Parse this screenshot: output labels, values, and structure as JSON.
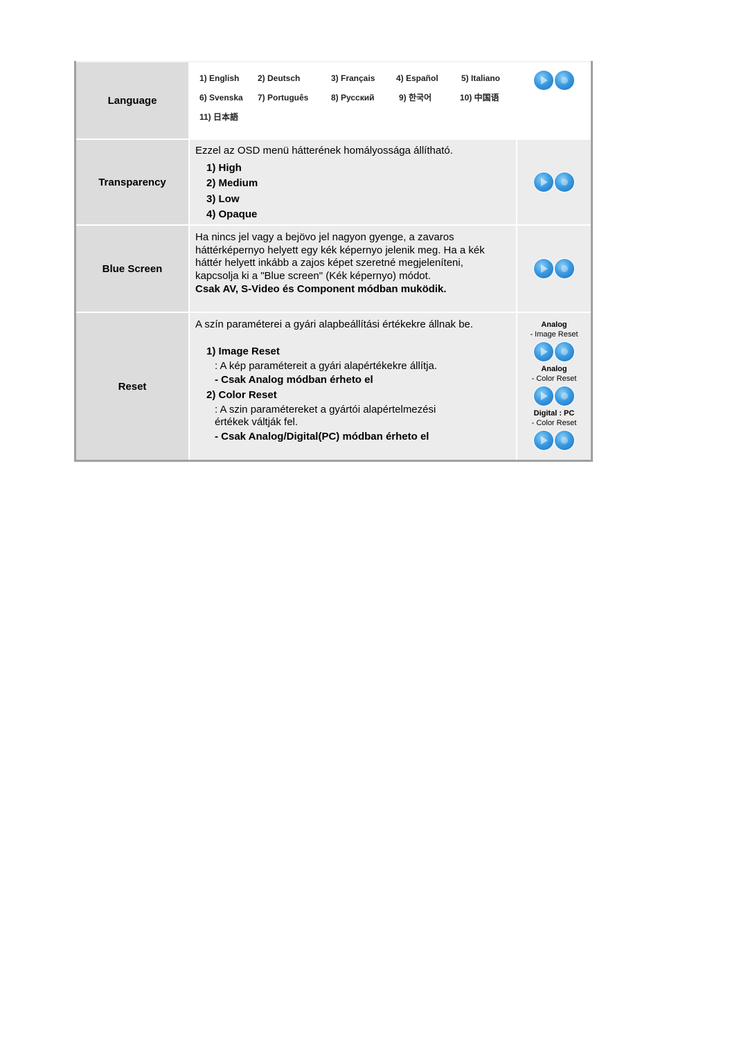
{
  "rows": [
    {
      "label": "Language",
      "languages": [
        [
          "1) English",
          "2) Deutsch",
          "3) Français",
          "4) Español",
          "5) Italiano"
        ],
        [
          "6) Svenska",
          "7) Português",
          "8) Pусский",
          "9) 한국어",
          "10) 中国语"
        ],
        [
          "11) 日本語"
        ]
      ],
      "icons": [
        "play-button-icon",
        "enter-button-icon"
      ]
    },
    {
      "label": "Transparency",
      "description": "Ezzel az OSD menü hátterének homályossága állítható.",
      "options": [
        "1) High",
        "2) Medium",
        "3) Low",
        "4) Opaque"
      ],
      "icons": [
        "play-button-icon",
        "enter-button-icon"
      ]
    },
    {
      "label": "Blue Screen",
      "description": "Ha nincs jel vagy a bejövo jel nagyon gyenge, a zavaros háttérképernyo helyett egy kék képernyo jelenik meg. Ha a kék háttér helyett inkább a zajos képet szeretné megjeleníteni, kapcsolja ki a \"Blue screen\" (Kék képernyo) módot.",
      "note": "Csak AV, S-Video és Component módban muködik.",
      "icons": [
        "play-button-icon",
        "enter-button-icon"
      ]
    },
    {
      "label": "Reset",
      "description": "A szín paraméterei a gyári alapbeállítási értékekre állnak be.",
      "items": [
        {
          "title": "1) Image Reset",
          "text": ": A kép paramétereit a gyári alapértékekre állítja.",
          "note": "- Csak Analog módban érheto el"
        },
        {
          "title": "2) Color Reset",
          "text": ": A szin paramétereket a gyártói alapértelmezési értékek váltják fel.",
          "note": "- Csak Analog/Digital(PC) módban érheto el"
        }
      ],
      "icon_groups": [
        {
          "mode": "Analog",
          "function": "- Image Reset"
        },
        {
          "mode": "Analog",
          "function": "- Color Reset"
        },
        {
          "mode": "Digital : PC",
          "function": "- Color Reset"
        }
      ]
    }
  ]
}
